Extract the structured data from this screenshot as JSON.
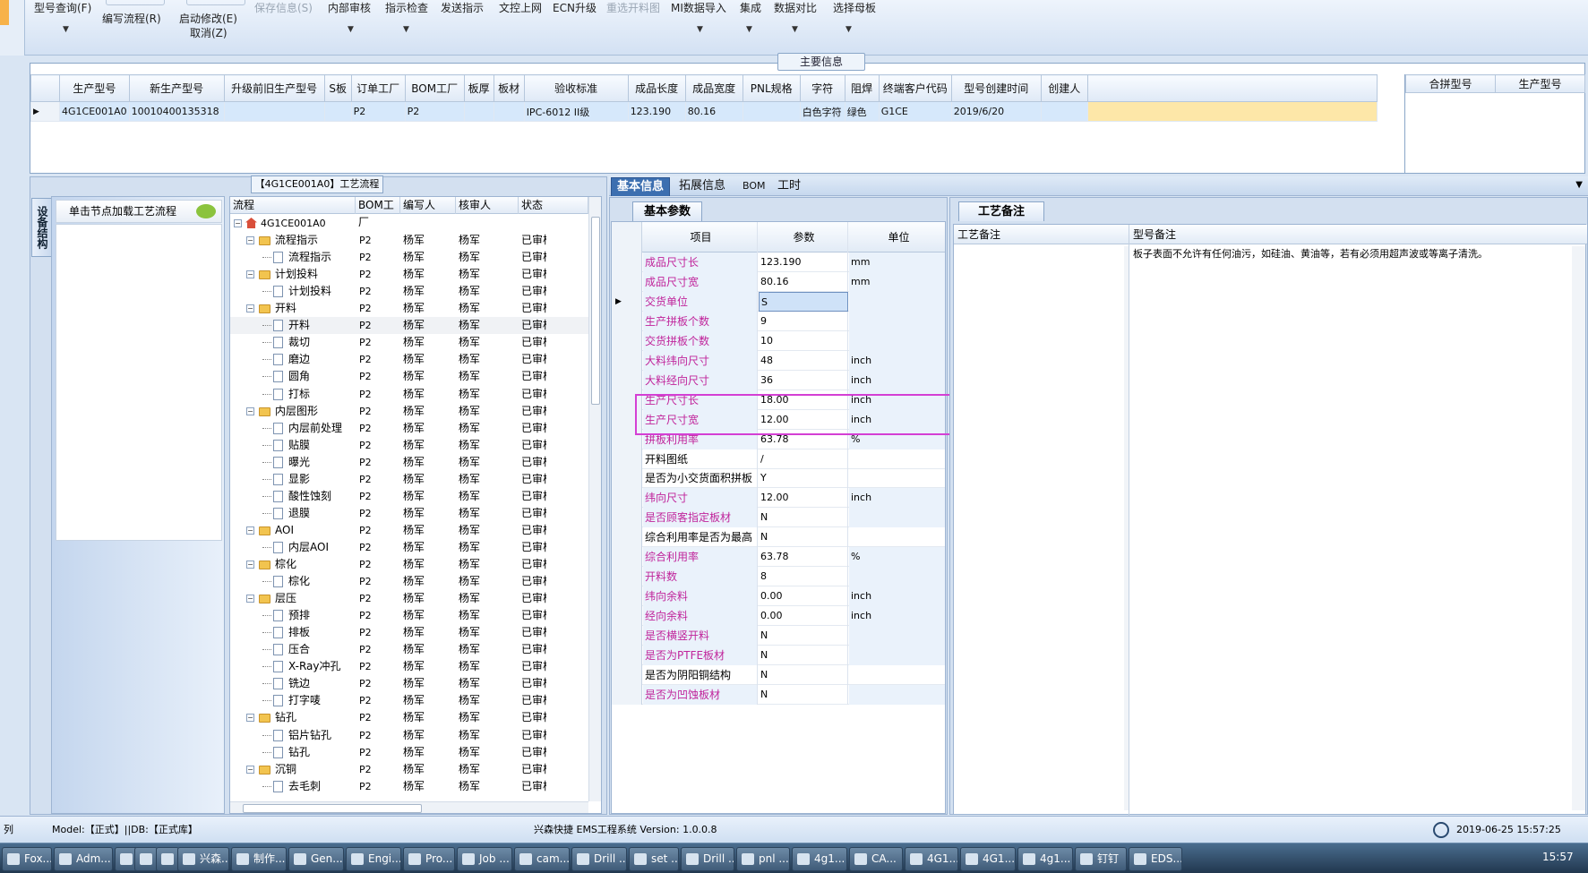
{
  "toolbar": {
    "buttons": [
      {
        "label": "型号查询(F)",
        "disabled": false
      },
      {
        "label": "编写流程(R)",
        "disabled": false
      },
      {
        "label": "启动修改(E)",
        "disabled": false
      },
      {
        "label": "取消(Z)",
        "disabled": false
      },
      {
        "label": "保存信息(S)",
        "disabled": true
      },
      {
        "label": "内部审核",
        "disabled": false
      },
      {
        "label": "指示检查",
        "disabled": false
      },
      {
        "label": "发送指示",
        "disabled": false
      },
      {
        "label": "文控上网",
        "disabled": false
      },
      {
        "label": "ECN升级",
        "disabled": false
      },
      {
        "label": "重选开料图",
        "disabled": true
      },
      {
        "label": "MI数据导入",
        "disabled": false
      },
      {
        "label": "集成",
        "disabled": false
      },
      {
        "label": "数据对比",
        "disabled": false
      },
      {
        "label": "选择母板",
        "disabled": false
      }
    ]
  },
  "main_info": {
    "title": "主要信息",
    "columns": [
      "生产型号",
      "新生产型号",
      "升级前旧生产型号",
      "S板",
      "订单工厂",
      "BOM工厂",
      "板厚",
      "板材",
      "验收标准",
      "成品长度",
      "成品宽度",
      "PNL规格",
      "字符",
      "阻焊",
      "终端客户代码",
      "型号创建时间",
      "创建人"
    ],
    "row": [
      "4G1CE001A0",
      "10010400135318",
      "",
      "",
      "P2",
      "P2",
      "",
      "",
      "IPC-6012 II级",
      "123.190",
      "80.16",
      "",
      "白色字符",
      "绿色",
      "G1CE",
      "2019/6/20",
      ""
    ],
    "merge_columns": [
      "合拼型号",
      "生产型号"
    ]
  },
  "flow": {
    "title": "【4G1CE001A0】工艺流程",
    "vtab": "设备结构",
    "node_hint": "单击节点加载工艺流程",
    "columns": [
      "流程",
      "BOM工厂",
      "编写人",
      "核审人",
      "状态"
    ],
    "root": "4G1CE001A0",
    "rows": [
      {
        "name": "流程指示",
        "level": 1,
        "folder": true
      },
      {
        "name": "流程指示",
        "level": 2,
        "folder": false
      },
      {
        "name": "计划投料",
        "level": 1,
        "folder": true
      },
      {
        "name": "计划投料",
        "level": 2,
        "folder": false
      },
      {
        "name": "开料",
        "level": 1,
        "folder": true
      },
      {
        "name": "开料",
        "level": 2,
        "folder": false
      },
      {
        "name": "裁切",
        "level": 2,
        "folder": false
      },
      {
        "name": "磨边",
        "level": 2,
        "folder": false
      },
      {
        "name": "圆角",
        "level": 2,
        "folder": false
      },
      {
        "name": "打标",
        "level": 2,
        "folder": false
      },
      {
        "name": "内层图形",
        "level": 1,
        "folder": true
      },
      {
        "name": "内层前处理",
        "level": 2,
        "folder": false
      },
      {
        "name": "贴膜",
        "level": 2,
        "folder": false
      },
      {
        "name": "曝光",
        "level": 2,
        "folder": false
      },
      {
        "name": "显影",
        "level": 2,
        "folder": false
      },
      {
        "name": "酸性蚀刻",
        "level": 2,
        "folder": false
      },
      {
        "name": "退膜",
        "level": 2,
        "folder": false
      },
      {
        "name": "AOI",
        "level": 1,
        "folder": true
      },
      {
        "name": "内层AOI",
        "level": 2,
        "folder": false
      },
      {
        "name": "棕化",
        "level": 1,
        "folder": true
      },
      {
        "name": "棕化",
        "level": 2,
        "folder": false
      },
      {
        "name": "层压",
        "level": 1,
        "folder": true
      },
      {
        "name": "预排",
        "level": 2,
        "folder": false
      },
      {
        "name": "排板",
        "level": 2,
        "folder": false
      },
      {
        "name": "压合",
        "level": 2,
        "folder": false
      },
      {
        "name": "X-Ray冲孔",
        "level": 2,
        "folder": false
      },
      {
        "name": "铣边",
        "level": 2,
        "folder": false
      },
      {
        "name": "打字唛",
        "level": 2,
        "folder": false
      },
      {
        "name": "钻孔",
        "level": 1,
        "folder": true
      },
      {
        "name": "铝片钻孔",
        "level": 2,
        "folder": false
      },
      {
        "name": "钻孔",
        "level": 2,
        "folder": false
      },
      {
        "name": "沉铜",
        "level": 1,
        "folder": true
      },
      {
        "name": "去毛刺",
        "level": 2,
        "folder": false
      }
    ],
    "cell_bom": "P2",
    "cell_writer": "杨军",
    "cell_reviewer": "杨军",
    "cell_status": "已审核"
  },
  "tabs": [
    "基本信息",
    "拓展信息",
    "BOM",
    "工时"
  ],
  "params": {
    "tab": "基本参数",
    "columns": [
      "项目",
      "参数",
      "单位"
    ],
    "rows": [
      {
        "item": "成品尺寸长",
        "value": "123.190",
        "unit": "mm",
        "pink": true
      },
      {
        "item": "成品尺寸宽",
        "value": "80.16",
        "unit": "mm",
        "pink": true
      },
      {
        "item": "交货单位",
        "value": "S",
        "unit": "",
        "pink": true
      },
      {
        "item": "生产拼板个数",
        "value": "9",
        "unit": "",
        "pink": true
      },
      {
        "item": "交货拼板个数",
        "value": "10",
        "unit": "",
        "pink": true
      },
      {
        "item": "大料纬向尺寸",
        "value": "48",
        "unit": "inch",
        "pink": true
      },
      {
        "item": "大料经向尺寸",
        "value": "36",
        "unit": "inch",
        "pink": true
      },
      {
        "item": "生产尺寸长",
        "value": "18.00",
        "unit": "inch",
        "pink": true
      },
      {
        "item": "生产尺寸宽",
        "value": "12.00",
        "unit": "inch",
        "pink": true
      },
      {
        "item": "拼板利用率",
        "value": "63.78",
        "unit": "%",
        "pink": true
      },
      {
        "item": "开料图纸",
        "value": "/",
        "unit": "",
        "pink": false
      },
      {
        "item": "是否为小交货面积拼板",
        "value": "Y",
        "unit": "",
        "pink": false
      },
      {
        "item": "纬向尺寸",
        "value": "12.00",
        "unit": "inch",
        "pink": true
      },
      {
        "item": "是否顾客指定板材",
        "value": "N",
        "unit": "",
        "pink": true
      },
      {
        "item": "综合利用率是否为最高",
        "value": "N",
        "unit": "",
        "pink": false
      },
      {
        "item": "综合利用率",
        "value": "63.78",
        "unit": "%",
        "pink": true
      },
      {
        "item": "开料数",
        "value": "8",
        "unit": "",
        "pink": true
      },
      {
        "item": "纬向余料",
        "value": "0.00",
        "unit": "inch",
        "pink": true
      },
      {
        "item": "经向余料",
        "value": "0.00",
        "unit": "inch",
        "pink": true
      },
      {
        "item": "是否横竖开料",
        "value": "N",
        "unit": "",
        "pink": true
      },
      {
        "item": "是否为PTFE板材",
        "value": "N",
        "unit": "",
        "pink": true
      },
      {
        "item": "是否为阴阳铜结构",
        "value": "N",
        "unit": "",
        "pink": false
      },
      {
        "item": "是否为凹蚀板材",
        "value": "N",
        "unit": "",
        "pink": true
      }
    ]
  },
  "remarks": {
    "tab": "工艺备注",
    "col1": "工艺备注",
    "col2": "型号备注",
    "model_remark": "板子表面不允许有任何油污，如硅油、黄油等，若有必须用超声波或等离子清洗。"
  },
  "status": {
    "left": "列",
    "model": "Model:【正式】||DB:【正式库】",
    "app": "兴森快捷 EMS工程系统 Version: 1.0.0.8",
    "datetime": "2019-06-25 15:57:25"
  },
  "taskbar": {
    "items": [
      "Fox...",
      "Adm...",
      "",
      "",
      "",
      "兴森...",
      "制作...",
      "Gen...",
      "Engi...",
      "Pro...",
      "Job ...",
      "cam...",
      "Drill ...",
      "set ...",
      "Drill ...",
      "pnl ...",
      "4g1...",
      "CA...",
      "4G1...",
      "4G1...",
      "4g1...",
      "钉钉",
      "EDS..."
    ],
    "clock": "15:57"
  }
}
